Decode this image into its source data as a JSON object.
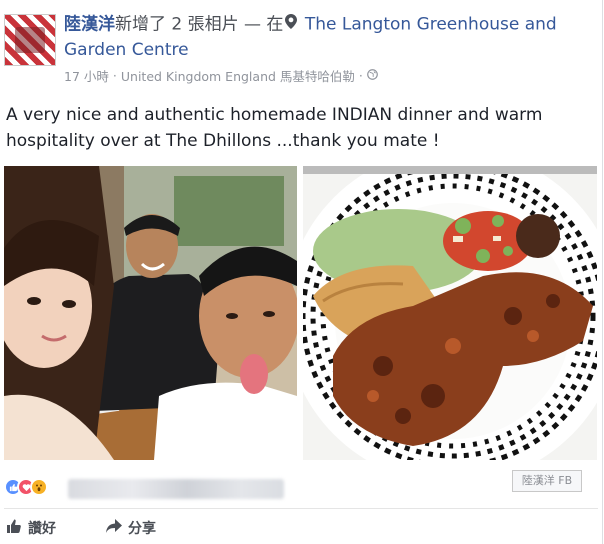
{
  "post": {
    "author": "陸漢洋",
    "action_text": "新增了 2 張相片 — 在",
    "place": "The Langton Greenhouse and Garden Centre",
    "time": "17 小時",
    "location": "United Kingdom England 馬基特哈伯勒",
    "separator": "·",
    "caption": "A very nice and authentic homemade INDIAN dinner and warm hospitality over at The Dhillons ...thank you mate !"
  },
  "reactions": {
    "icons": [
      "like-icon",
      "love-icon",
      "wow-icon"
    ]
  },
  "watermark": "陸漢洋 FB",
  "actions": {
    "like_label": "讚好",
    "share_label": "分享"
  },
  "colors": {
    "link": "#365899",
    "meta": "#90949c",
    "like_blue": "#5890ff",
    "love_red": "#f25268",
    "wow_yellow": "#f7b125"
  }
}
